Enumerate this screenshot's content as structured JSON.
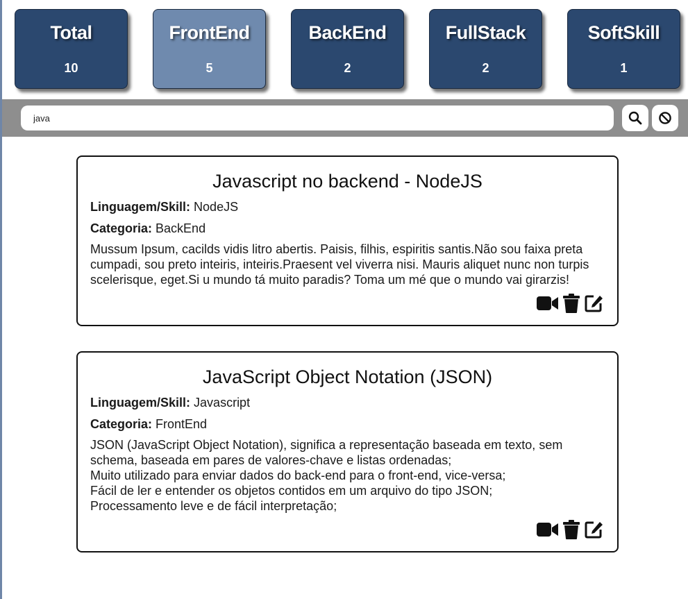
{
  "stats": [
    {
      "title": "Total",
      "count": "10",
      "active": false
    },
    {
      "title": "FrontEnd",
      "count": "5",
      "active": true
    },
    {
      "title": "BackEnd",
      "count": "2",
      "active": false
    },
    {
      "title": "FullStack",
      "count": "2",
      "active": false
    },
    {
      "title": "SoftSkill",
      "count": "1",
      "active": false
    }
  ],
  "search": {
    "value": "java",
    "search_icon": "search-icon",
    "clear_icon": "ban-icon"
  },
  "labels": {
    "language": "Linguagem/Skill:",
    "category": "Categoria:"
  },
  "posts": [
    {
      "title": "Javascript no backend - NodeJS",
      "language": "NodeJS",
      "category": "BackEnd",
      "description": "Mussum Ipsum, cacilds vidis litro abertis. Paisis, filhis, espiritis santis.Não sou faixa preta cumpadi, sou preto inteiris, inteiris.Praesent vel viverra nisi. Mauris aliquet nunc non turpis scelerisque, eget.Si u mundo tá muito paradis? Toma um mé que o mundo vai girarzis!"
    },
    {
      "title": "JavaScript Object Notation (JSON)",
      "language": "Javascript",
      "category": "FrontEnd",
      "description": "JSON (JavaScript Object Notation), significa a representação baseada em texto, sem schema, baseada em pares de valores-chave e listas ordenadas;\nMuito utilizado para enviar dados do back-end para o front-end, vice-versa;\nFácil de ler e entender os objetos contidos em um arquivo do tipo JSON;\nProcessamento leve e de fácil interpretação;"
    }
  ],
  "colors": {
    "card": "#2b486f",
    "card_active": "#6f8aae",
    "search_bar": "#8e8e8e"
  }
}
